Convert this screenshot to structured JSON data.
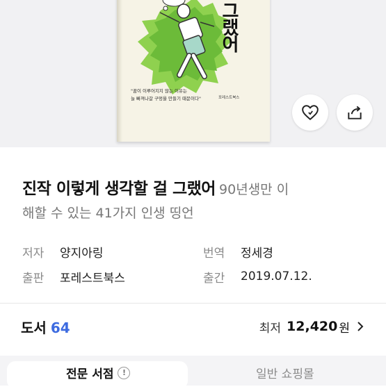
{
  "cover": {
    "title_vertical": "그랬어",
    "tagline_line1": "\"꿈이 이루어지지 않는 이유는",
    "tagline_line2": "늘 빠져나갈 구멍을 만들기 때문이다\"",
    "publisher_mark": "포레스트북스"
  },
  "actions": {
    "like_icon": "heart-icon",
    "share_icon": "share-icon"
  },
  "book": {
    "title": "진작 이렇게 생각할 걸 그랬어",
    "subtitle_part1": "90년생만 이",
    "subtitle_part2": "해할 수 있는 41가지 인생 띵언"
  },
  "meta": {
    "author_label": "저자",
    "author": "양지아링",
    "translator_label": "번역",
    "translator": "정세경",
    "publisher_label": "출판",
    "publisher": "포레스트북스",
    "date_label": "출간",
    "date": "2019.07.12."
  },
  "price": {
    "category": "도서",
    "count": "64",
    "lowest_label": "최저",
    "lowest_price": "12,420",
    "currency": "원",
    "chevron_icon": "chevron-right-icon"
  },
  "tabs": {
    "specialist": "전문 서점",
    "general": "일반 쇼핑몰",
    "info_icon": "info-icon"
  },
  "colors": {
    "accent_blue": "#3d6be0",
    "cover_green": "#8fd14f"
  }
}
